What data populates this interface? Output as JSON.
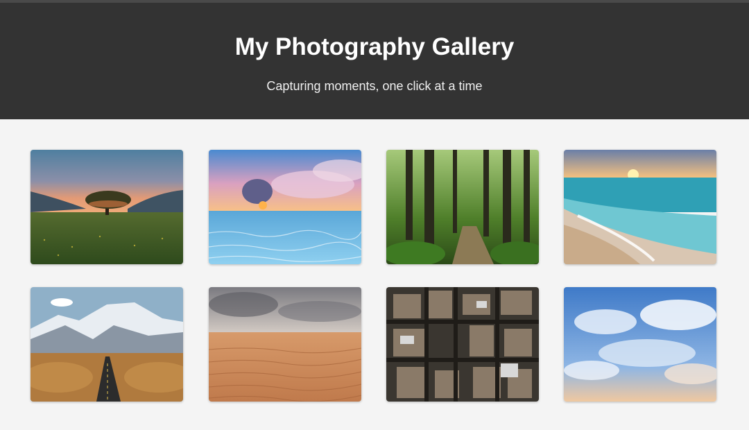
{
  "header": {
    "title": "My Photography Gallery",
    "subtitle": "Capturing moments, one click at a time"
  },
  "gallery": {
    "photos": [
      {
        "subject": "lone-tree-sunset"
      },
      {
        "subject": "ocean-clouds-sunset"
      },
      {
        "subject": "forest-path"
      },
      {
        "subject": "beach-waves-sunrise"
      },
      {
        "subject": "snowy-mountain-road"
      },
      {
        "subject": "desert-dunes"
      },
      {
        "subject": "aerial-city"
      },
      {
        "subject": "blue-sky-clouds"
      }
    ]
  },
  "colors": {
    "header_bg": "#333333",
    "page_bg": "#f4f4f4",
    "title_text": "#ffffff"
  }
}
